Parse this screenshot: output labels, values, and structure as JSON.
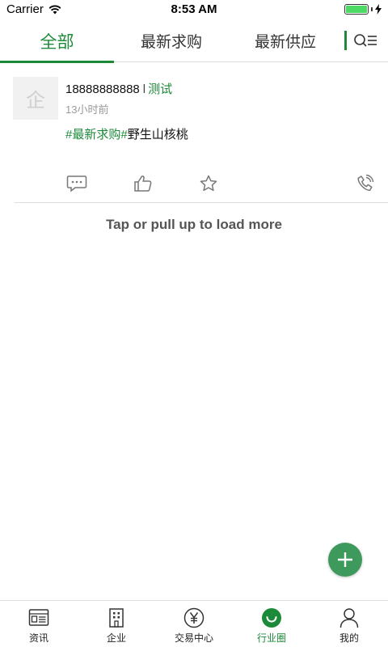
{
  "status_bar": {
    "carrier": "Carrier",
    "time": "8:53 AM",
    "battery_level": 1.0
  },
  "tabs": [
    {
      "label": "全部",
      "active": true
    },
    {
      "label": "最新求购",
      "active": false
    },
    {
      "label": "最新供应",
      "active": false
    }
  ],
  "tab_actions": {
    "icon": "search-list-icon"
  },
  "feed": [
    {
      "avatar_text": "企",
      "phone": "18888888888",
      "separator": "l",
      "company": "测试",
      "time": "13小时前",
      "tag": "#最新求购#",
      "content": "野生山核桃",
      "actions": [
        "comment-icon",
        "like-icon",
        "favorite-icon",
        "phone-icon"
      ]
    }
  ],
  "load_more": "Tap or pull up to load more",
  "fab": {
    "icon": "plus-icon"
  },
  "bottom_nav": [
    {
      "label": "资讯",
      "icon": "news-icon",
      "active": false
    },
    {
      "label": "企业",
      "icon": "building-icon",
      "active": false
    },
    {
      "label": "交易中心",
      "icon": "yen-icon",
      "active": false
    },
    {
      "label": "行业圈",
      "icon": "circle-icon",
      "active": true
    },
    {
      "label": "我的",
      "icon": "user-icon",
      "active": false
    }
  ],
  "colors": {
    "accent": "#1d8a3a",
    "fab": "#3d9a5c",
    "muted": "#9a9a9a",
    "divider": "#dcdcdc"
  }
}
